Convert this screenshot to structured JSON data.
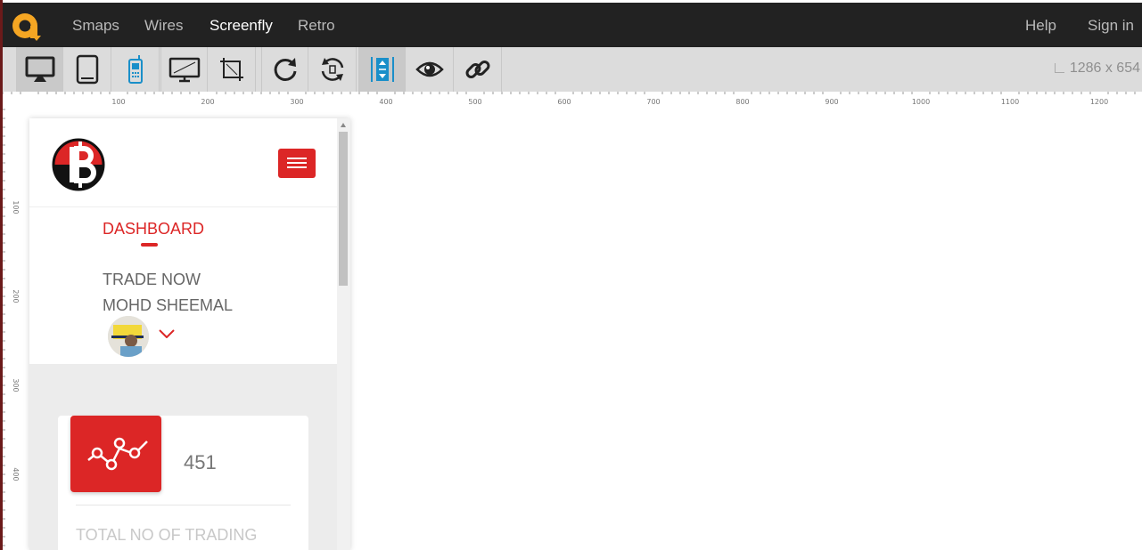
{
  "topnav": {
    "items": [
      {
        "label": "Smaps"
      },
      {
        "label": "Wires"
      },
      {
        "label": "Screenfly"
      },
      {
        "label": "Retro"
      }
    ],
    "help_label": "Help",
    "signin_label": "Sign in",
    "colors": {
      "bar": "#222222",
      "logo": "#f5a623"
    }
  },
  "toolbar": {
    "buttons": [
      {
        "icon": "desktop-icon"
      },
      {
        "icon": "tablet-icon"
      },
      {
        "icon": "mobile-icon"
      },
      {
        "icon": "television-icon"
      },
      {
        "icon": "custom-size-icon"
      },
      {
        "icon": "rotate-icon"
      },
      {
        "icon": "rotate-device-icon"
      },
      {
        "icon": "scroll-toggle-icon"
      },
      {
        "icon": "preview-eye-icon"
      },
      {
        "icon": "share-link-icon"
      }
    ],
    "dimensions": "1286 x 654",
    "accent": "#1a8fc9"
  },
  "rulers": {
    "top": [
      "100",
      "200",
      "300",
      "400",
      "500",
      "600",
      "700",
      "800",
      "900",
      "1000",
      "1100",
      "1200"
    ],
    "left": [
      "100",
      "200",
      "300",
      "400"
    ]
  },
  "site": {
    "menu": {
      "dashboard": "DASHBOARD",
      "trade_now": "TRADE NOW",
      "user_name": "MOHD SHEEMAL"
    },
    "card": {
      "value": "451",
      "label": "TOTAL NO OF TRADING"
    },
    "colors": {
      "accent": "#dc2626"
    }
  }
}
